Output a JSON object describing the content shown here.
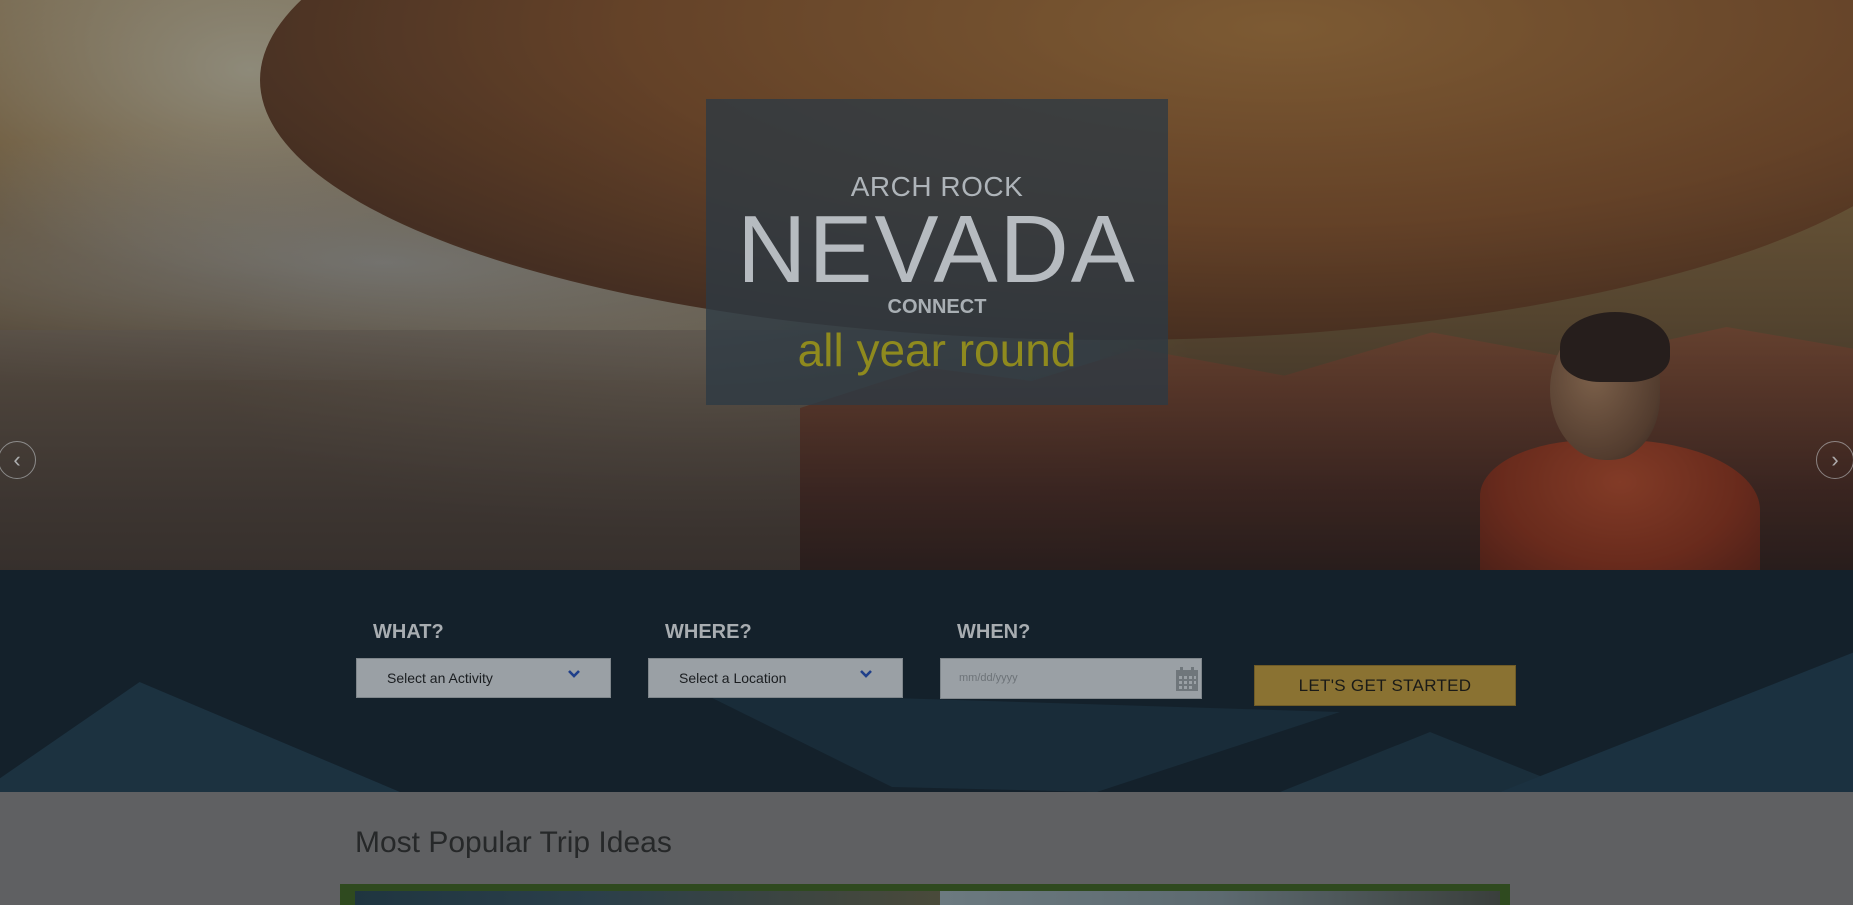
{
  "hero": {
    "kicker": "ARCH ROCK",
    "title": "NEVADA",
    "subtitle": "CONNECT",
    "tagline": "all year round",
    "prev_arrow": "‹",
    "next_arrow": "›"
  },
  "search": {
    "what_label": "WHAT?",
    "what_value": "Select an Activity",
    "where_label": "WHERE?",
    "where_value": "Select a Location",
    "when_label": "WHEN?",
    "when_placeholder": "mm/dd/yyyy",
    "submit_label": "LET'S GET STARTED"
  },
  "popular": {
    "heading": "Most Popular Trip Ideas"
  },
  "colors": {
    "tagline": "#8f8a1e",
    "cta": "#8a7232",
    "band": "#14212b",
    "chevron": "#1f3f8a"
  },
  "icons": {
    "prev": "chevron-left-icon",
    "next": "chevron-right-icon",
    "dropdown": "chevron-down-icon",
    "calendar": "calendar-icon"
  }
}
